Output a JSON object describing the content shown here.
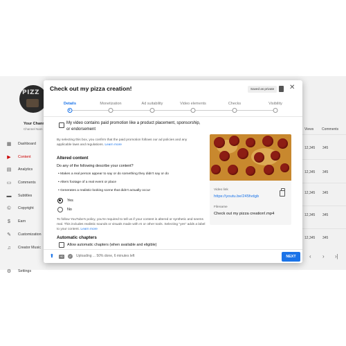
{
  "background": {
    "channel_name": "Your Chann",
    "channel_sub": "Channel Nam",
    "avatar_text": "PIZZ",
    "nav": [
      {
        "label": "Dashboard",
        "icon": "dashboard-icon",
        "glyph": "▦"
      },
      {
        "label": "Content",
        "icon": "content-icon",
        "glyph": "▶",
        "active": true
      },
      {
        "label": "Analytics",
        "icon": "analytics-icon",
        "glyph": "▤"
      },
      {
        "label": "Comments",
        "icon": "comments-icon",
        "glyph": "▭"
      },
      {
        "label": "Subtitles",
        "icon": "subtitles-icon",
        "glyph": "▬"
      },
      {
        "label": "Copyright",
        "icon": "copyright-icon",
        "glyph": "©"
      },
      {
        "label": "Earn",
        "icon": "earn-icon",
        "glyph": "$"
      },
      {
        "label": "Customization",
        "icon": "customization-icon",
        "glyph": "✎"
      },
      {
        "label": "Creator Music",
        "icon": "creator-music-icon",
        "glyph": "♫"
      }
    ],
    "settings_label": "Settings",
    "table_headers": {
      "views": "Views",
      "comments": "Comments"
    },
    "rows": [
      {
        "views": "12,345",
        "comments": "345"
      },
      {
        "views": "12,345",
        "comments": "345"
      },
      {
        "views": "12,345",
        "comments": "345"
      },
      {
        "views": "12,345",
        "comments": "345"
      },
      {
        "views": "12,345",
        "comments": "345"
      }
    ]
  },
  "modal": {
    "title": "Check out my pizza creation!",
    "saved_badge": "Saved as private",
    "steps": [
      {
        "label": "Details",
        "active": true
      },
      {
        "label": "Monetization"
      },
      {
        "label": "Ad suitability"
      },
      {
        "label": "Video elements"
      },
      {
        "label": "Checks"
      },
      {
        "label": "Visibility"
      }
    ],
    "paid_promo": {
      "label": "My video contains paid promotion like a product placement, sponsorship, or endorsement",
      "checked": false,
      "note": "By selecting this box, you confirm that the paid promotion follows our ad policies and any applicable laws and regulations.",
      "link": "Learn more"
    },
    "altered_content": {
      "title": "Altered content",
      "question": "Do any of the following describe your content?",
      "bullets": [
        "Makes a real person appear to say or do something they didn't say or do",
        "Alters footage of a real event or place",
        "Generates a realistic-looking scene that didn't actually occur"
      ],
      "options": [
        {
          "label": "Yes",
          "selected": true
        },
        {
          "label": "No",
          "selected": false
        }
      ],
      "note": "To follow YouTube's policy, you're required to tell us if your content is altered or synthetic and seems real. This includes realistic sounds or visuals made with AI or other tools. Selecting \"yes\" adds a label to your content.",
      "link": "Learn more"
    },
    "chapters": {
      "title": "Automatic chapters",
      "label": "Allow automatic chapters (when available and eligible)",
      "checked": false
    },
    "preview": {
      "video_link_label": "Video link",
      "video_link": "https://youtu.be/245fvdgb",
      "filename_label": "Filename",
      "filename": "Check out my pizza creation!.mp4"
    },
    "footer": {
      "status": "Uploading ... 50% done, 6 minutes left",
      "progress_percent": 50,
      "next_label": "NEXT",
      "hd_badge": "HD"
    }
  },
  "colors": {
    "accent": "#1a73e8",
    "active_nav": "#cc0000"
  }
}
